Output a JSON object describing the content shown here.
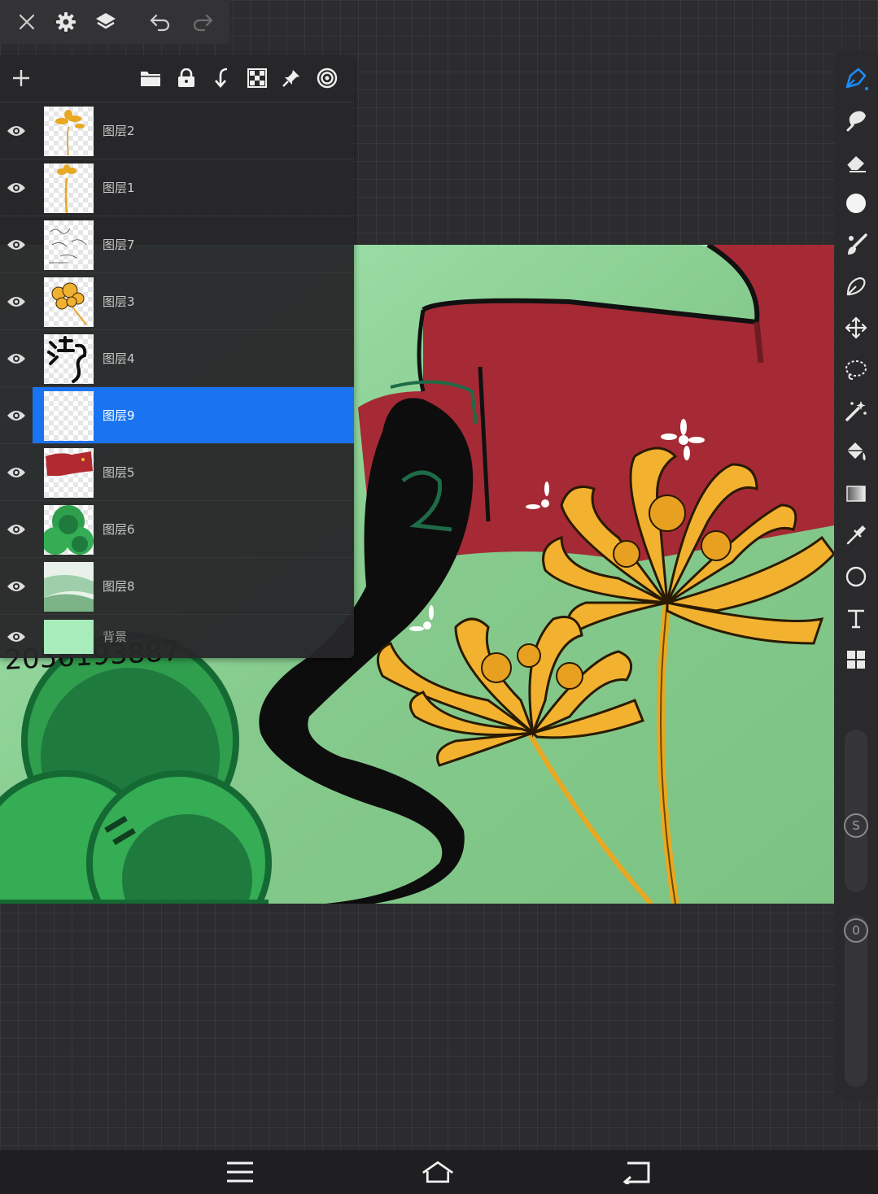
{
  "toolbar": {
    "close_icon": "close-icon",
    "settings_icon": "gear-icon",
    "layers_icon": "layers-icon",
    "undo_icon": "undo-icon",
    "redo_icon": "redo-icon"
  },
  "layers_panel": {
    "tools": [
      "add-layer-icon",
      "folder-icon",
      "lock-icon",
      "merge-down-icon",
      "checker-icon",
      "pin-icon",
      "target-icon"
    ],
    "layers": [
      {
        "name": "图层2",
        "visible": true,
        "selected": false
      },
      {
        "name": "图层1",
        "visible": true,
        "selected": false
      },
      {
        "name": "图层7",
        "visible": true,
        "selected": false
      },
      {
        "name": "图层3",
        "visible": true,
        "selected": false
      },
      {
        "name": "图层4",
        "visible": true,
        "selected": false
      },
      {
        "name": "图层9",
        "visible": true,
        "selected": true
      },
      {
        "name": "图层5",
        "visible": true,
        "selected": false
      },
      {
        "name": "图层6",
        "visible": true,
        "selected": false
      },
      {
        "name": "图层8",
        "visible": true,
        "selected": false
      }
    ],
    "background": {
      "name": "背景",
      "visible": true,
      "color": "#a8ecbb"
    },
    "selection_color": "#1a73f0"
  },
  "tools_rail": {
    "tools": [
      "pen-tool-icon",
      "smudge-icon",
      "eraser-icon",
      "brush-size-icon",
      "brush-icon",
      "lasso-pen-icon",
      "move-icon",
      "lasso-select-icon",
      "magic-wand-icon",
      "fill-bucket-icon",
      "gradient-icon",
      "eyedropper-icon",
      "shape-circle-icon",
      "text-icon",
      "grid-icon"
    ],
    "size_label": "S",
    "opacity_label": "0",
    "accent": "#1a8cff"
  },
  "nav": {
    "menu_icon": "menu-icon",
    "home_icon": "home-icon",
    "back_icon": "back-icon"
  }
}
